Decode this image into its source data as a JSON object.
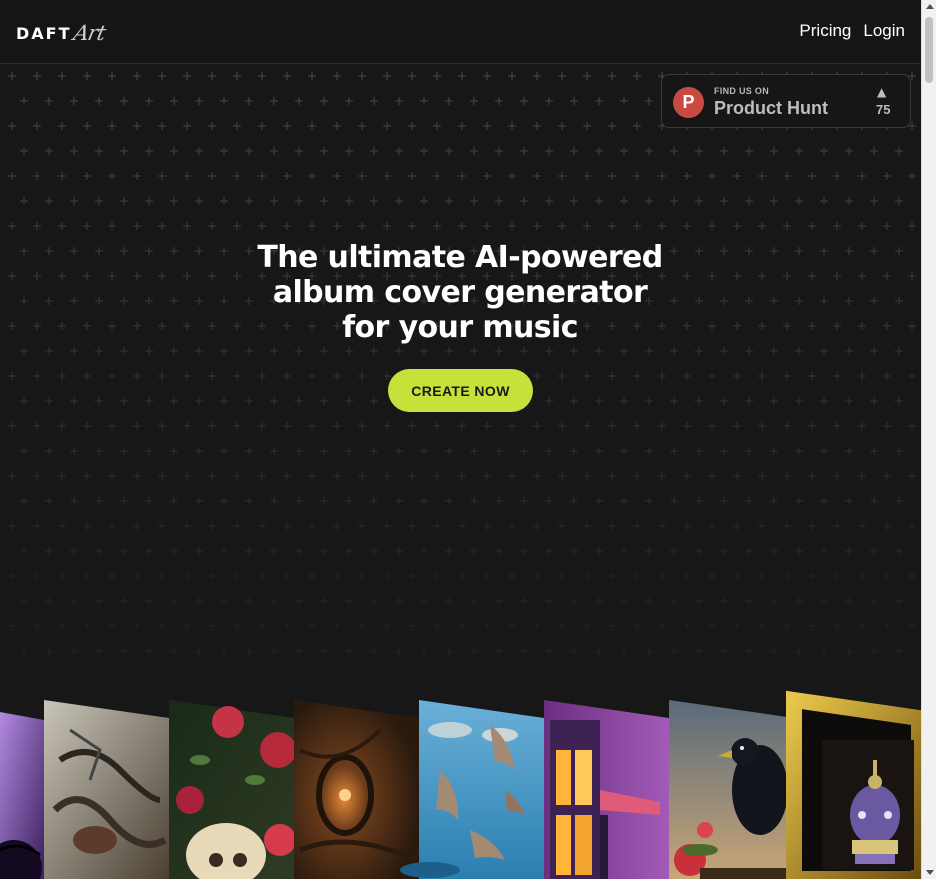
{
  "header": {
    "logo_primary": "DAFT",
    "logo_secondary": "Art",
    "nav": [
      {
        "label": "Pricing"
      },
      {
        "label": "Login"
      }
    ]
  },
  "product_hunt": {
    "kicker": "FIND US ON",
    "name": "Product Hunt",
    "logo_letter": "P",
    "upvote_icon": "▲",
    "count": "75"
  },
  "hero": {
    "title_lines": [
      "The ultimate AI-powered",
      "album cover generator",
      "for your music"
    ],
    "cta_label": "CREATE NOW"
  },
  "covers": [
    {
      "name": "purple-orb-cover"
    },
    {
      "name": "ink-wash-figures-cover"
    },
    {
      "name": "skull-and-roses-cover"
    },
    {
      "name": "glowing-tree-hollow-cover"
    },
    {
      "name": "leaping-dolphins-cover"
    },
    {
      "name": "neon-window-cover"
    },
    {
      "name": "raven-and-roses-cover"
    },
    {
      "name": "jeweled-crown-cover"
    }
  ],
  "colors": {
    "background": "#171717",
    "accent": "#c4e23a",
    "product_hunt_red": "#c84a43"
  }
}
